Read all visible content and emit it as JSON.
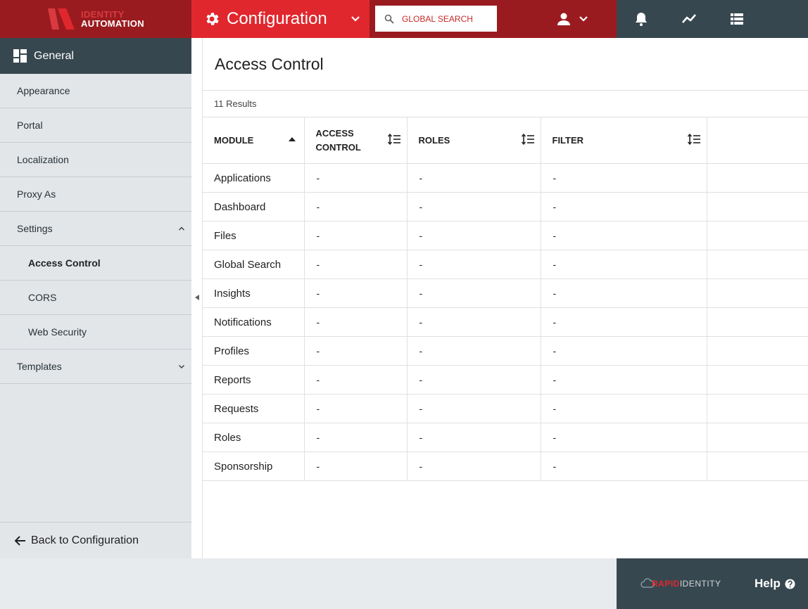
{
  "header": {
    "logo": {
      "line1": "IDENTITY",
      "line2": "AUTOMATION"
    },
    "section_title": "Configuration",
    "search": {
      "placeholder": "GLOBAL SEARCH"
    },
    "icons": [
      "gear-icon",
      "search-icon",
      "person-icon",
      "bell-icon",
      "trend-icon",
      "list-icon"
    ]
  },
  "sidebar": {
    "section": "General",
    "items": [
      {
        "label": "Appearance"
      },
      {
        "label": "Portal"
      },
      {
        "label": "Localization"
      },
      {
        "label": "Proxy As"
      },
      {
        "label": "Settings",
        "expanded": true
      },
      {
        "label": "Access Control",
        "active": true
      },
      {
        "label": "CORS"
      },
      {
        "label": "Web Security"
      },
      {
        "label": "Templates",
        "expanded": false
      }
    ],
    "back_label": "Back to Configuration"
  },
  "main": {
    "title": "Access Control",
    "results": "11 Results",
    "columns": [
      {
        "line1": "MODULE",
        "line2": ""
      },
      {
        "line1": "ACCESS",
        "line2": "CONTROL"
      },
      {
        "line1": "ROLES",
        "line2": ""
      },
      {
        "line1": "FILTER",
        "line2": ""
      }
    ],
    "rows": [
      {
        "module": "Applications",
        "access_control": "-",
        "roles": "-",
        "filter": "-"
      },
      {
        "module": "Dashboard",
        "access_control": "-",
        "roles": "-",
        "filter": "-"
      },
      {
        "module": "Files",
        "access_control": "-",
        "roles": "-",
        "filter": "-"
      },
      {
        "module": "Global Search",
        "access_control": "-",
        "roles": "-",
        "filter": "-"
      },
      {
        "module": "Insights",
        "access_control": "-",
        "roles": "-",
        "filter": "-"
      },
      {
        "module": "Notifications",
        "access_control": "-",
        "roles": "-",
        "filter": "-"
      },
      {
        "module": "Profiles",
        "access_control": "-",
        "roles": "-",
        "filter": "-"
      },
      {
        "module": "Reports",
        "access_control": "-",
        "roles": "-",
        "filter": "-"
      },
      {
        "module": "Requests",
        "access_control": "-",
        "roles": "-",
        "filter": "-"
      },
      {
        "module": "Roles",
        "access_control": "-",
        "roles": "-",
        "filter": "-"
      },
      {
        "module": "Sponsorship",
        "access_control": "-",
        "roles": "-",
        "filter": "-"
      }
    ]
  },
  "footer": {
    "brand": {
      "part1": "RAPID",
      "part2": "IDENTITY"
    },
    "help_label": "Help"
  },
  "colors": {
    "brand_red": "#e0272d",
    "dark_red": "#9a1b1f",
    "slate": "#37474f",
    "sidebar_bg": "#e3e6e9"
  }
}
